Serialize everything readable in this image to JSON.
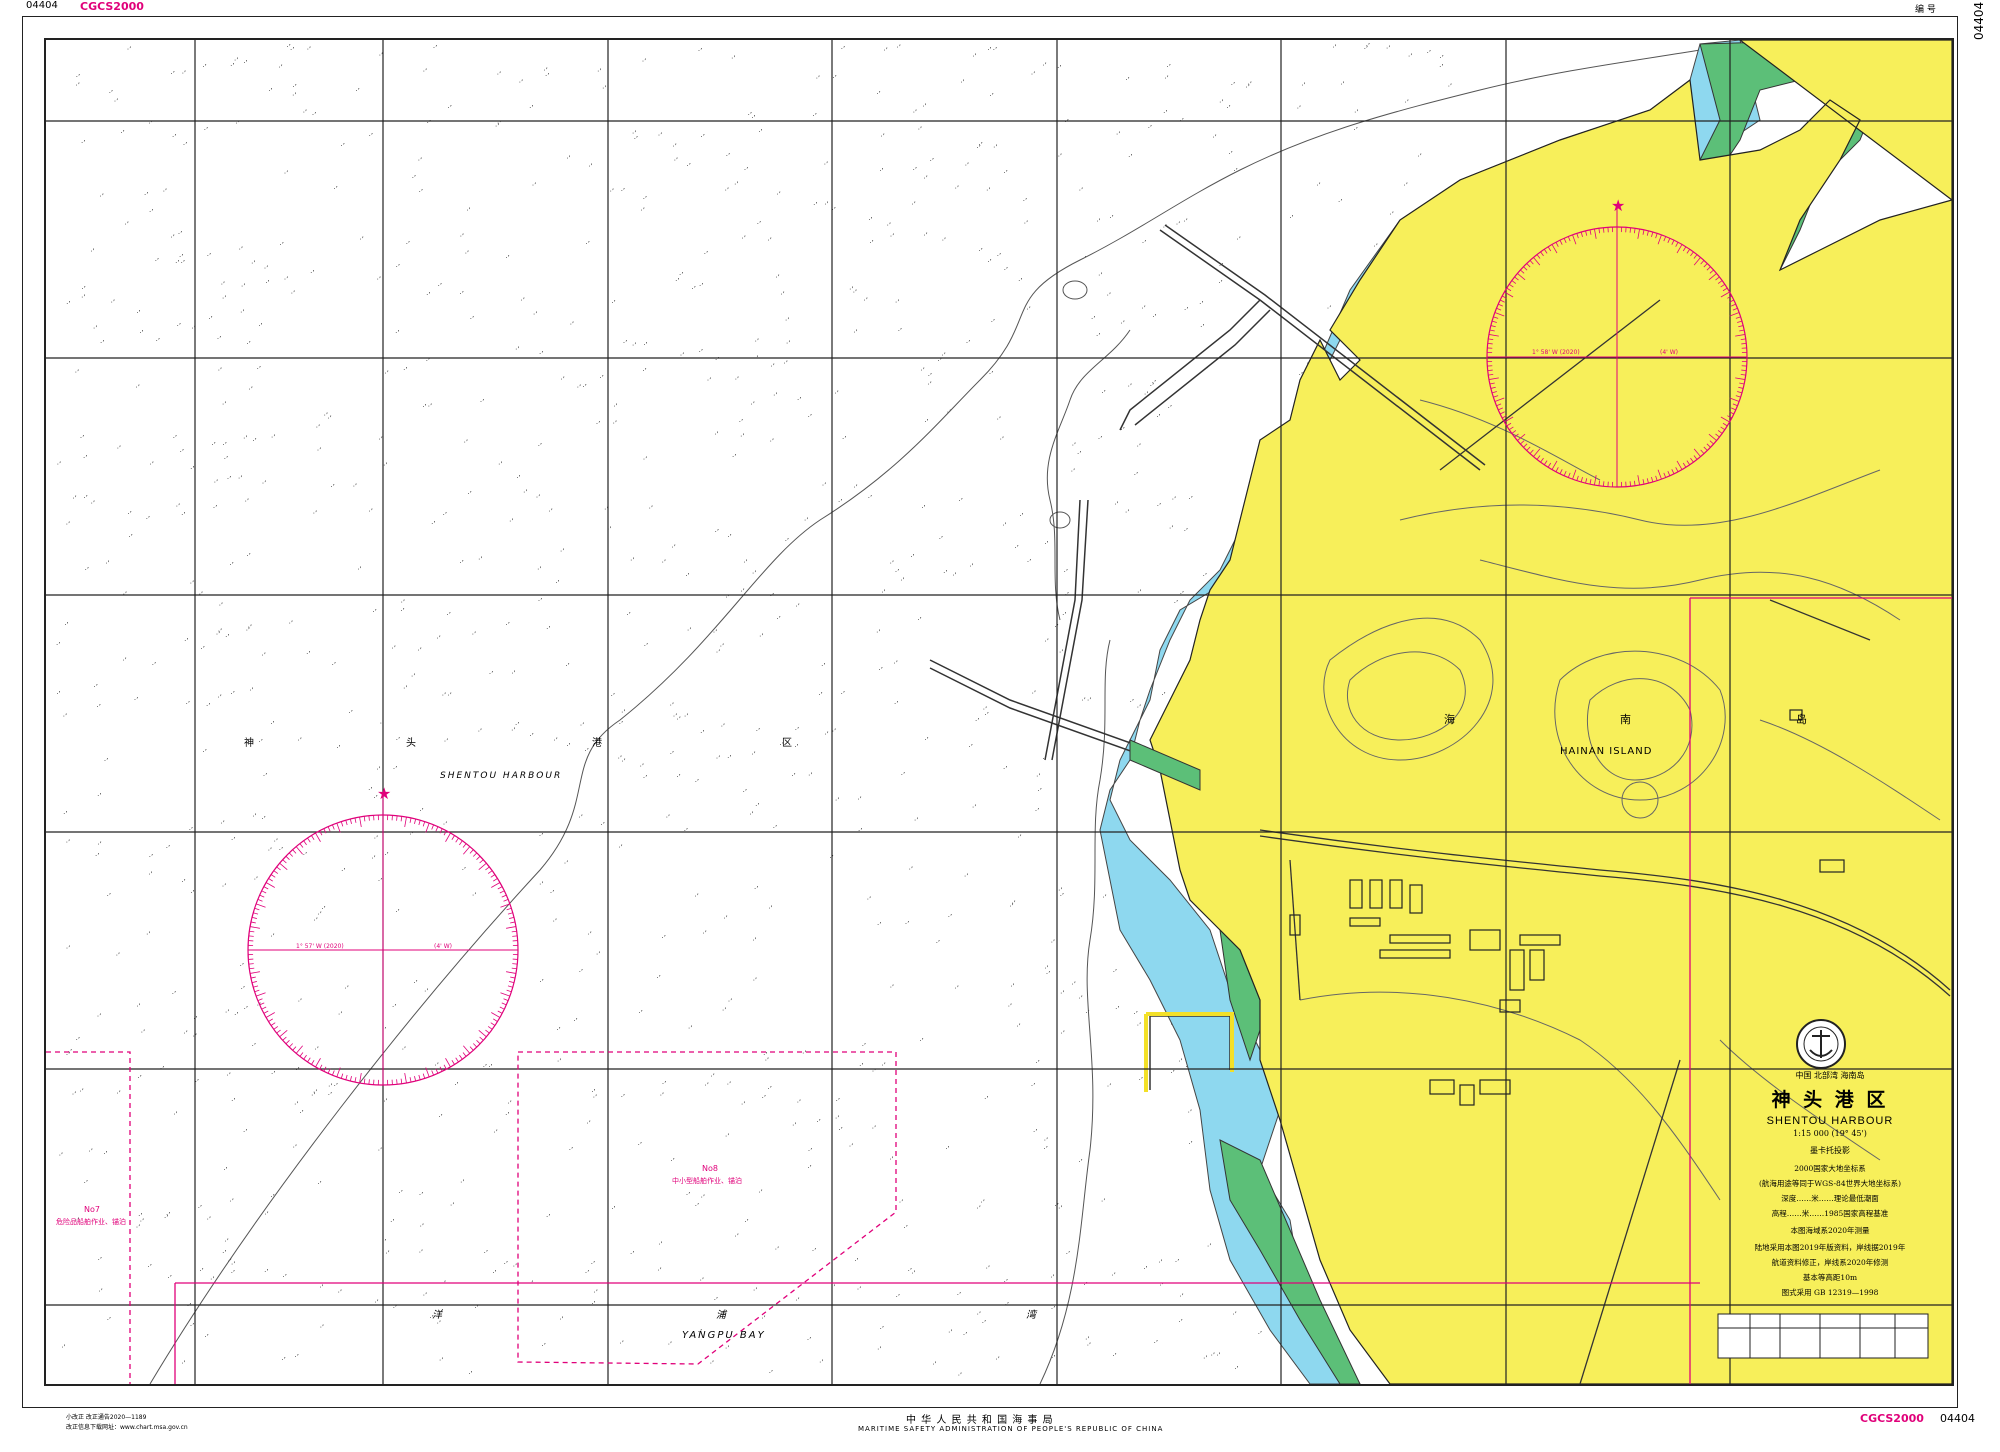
{
  "header": {
    "datum_tag_top": "CGCS2000",
    "chart_no_top": "04404",
    "number_label": "编 号",
    "chart_no_right": "04404",
    "chart_no_left": "04404"
  },
  "colors": {
    "land": "#f7ef5a",
    "intertidal": "#5cbf78",
    "shallow": "#8ed8ef",
    "sea": "#ffffff",
    "magenta": "#e0007a",
    "grid": "#222222"
  },
  "labels": {
    "harbour_cn": [
      "神",
      "头",
      "港",
      "区"
    ],
    "harbour_en": "SHENTOU HARBOUR",
    "island_cn": [
      "海",
      "南",
      "岛"
    ],
    "island_en": "HAINAN  ISLAND",
    "bay_cn": [
      "洋",
      "浦",
      "湾"
    ],
    "bay_en": "YANGPU BAY",
    "no7": "No7",
    "no7_text": "危险品船舶作业、锚泊",
    "no8": "No8",
    "no8_text": "中小型船舶作业、锚泊",
    "compass_left_west": "1° 57' W (2020)",
    "compass_left_east": "(4' W)",
    "compass_right_west": "1° 58' W (2020)",
    "compass_right_east": "(4' W)"
  },
  "title_block": {
    "region": "中国  北部湾  海南岛",
    "title_cn": "神 头 港 区",
    "title_en": "SHENTOU HARBOUR",
    "scale": "1:15 000 (19° 45')",
    "projection": "墨卡托投影",
    "lines": [
      "2000国家大地坐标系",
      "(航海用途等同于WGS-84世界大地坐标系)",
      "深度……米……理论最低潮面",
      "高程……米……1985国家高程基准",
      "本图海域系2020年测量",
      "陆地采用本图2019年版资料，岸线据2019年",
      "航道资料修正，岸线系2020年修测",
      "基本等高距10m",
      "图式采用 GB 12319—1998"
    ]
  },
  "footer": {
    "center_cn": "中 华 人 民 共 和 国 海 事 局",
    "center_en": "MARITIME SAFETY ADMINISTRATION OF PEOPLE'S REPUBLIC OF CHINA",
    "left_line1": "小改正  改正通告2020—1189",
    "left_line2": "改正信息下载网址：www.chart.msa.gov.cn",
    "right_datum": "CGCS2000",
    "right_no": "04404"
  }
}
